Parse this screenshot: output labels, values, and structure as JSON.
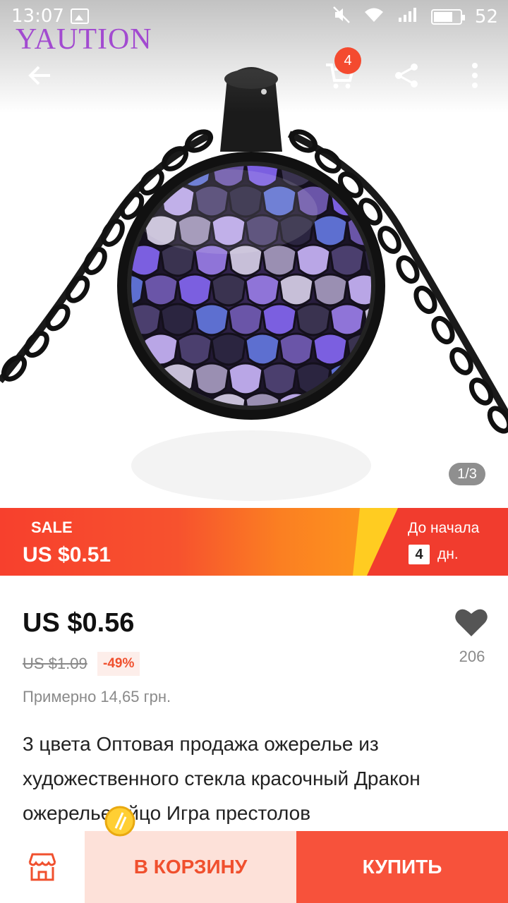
{
  "status_bar": {
    "time": "13:07",
    "battery": "52",
    "icons": [
      "image-icon",
      "mute-icon",
      "wifi-icon",
      "signal-icon",
      "battery-icon"
    ]
  },
  "watermark": "YAUTION",
  "toolbar": {
    "cart_count": "4",
    "icons": [
      "back-arrow-icon",
      "cart-icon",
      "share-icon",
      "more-icon"
    ]
  },
  "gallery": {
    "pager": "1/3"
  },
  "sale_banner": {
    "label": "SALE",
    "price": "US $0.51",
    "until_label": "До начала",
    "days_value": "4",
    "days_unit": "дн.",
    "colors": {
      "red": "#f7402d",
      "orange": "#fd9a1c",
      "yellow": "#ffcc21"
    }
  },
  "product": {
    "price": "US $0.56",
    "old_price": "US $1.09",
    "discount": "-49%",
    "approx": "Примерно 14,65 грн.",
    "wishlist_count": "206",
    "title": "3 цвета Оптовая продажа ожерелье из художественного стекла красочный Дракон ожерелье яйцо Игра престолов"
  },
  "bottom_bar": {
    "store_icon": "store-icon",
    "add_to_cart": "В КОРЗИНУ",
    "buy": "КУПИТЬ",
    "colors": {
      "add_bg": "#fde1d9",
      "buy_bg": "#f7523b"
    }
  }
}
